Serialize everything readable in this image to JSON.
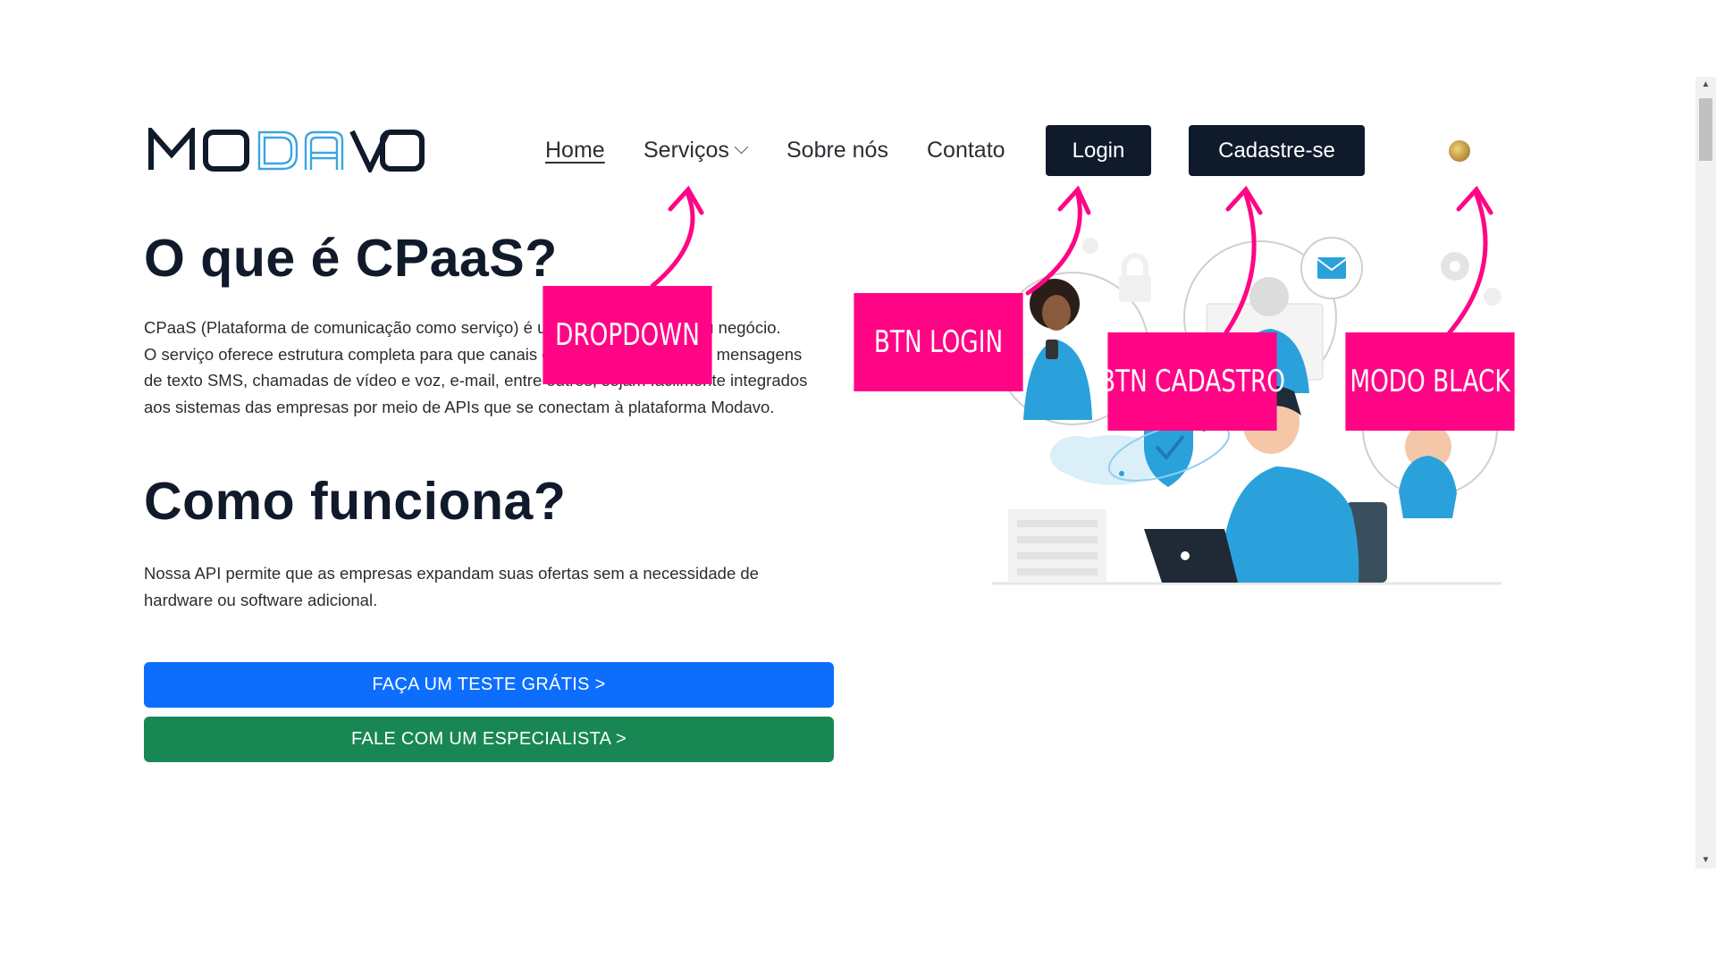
{
  "brand": {
    "logo_text": "MODAVO",
    "colors": {
      "dark": "#0f1a2b",
      "logo_accent": "#3aa6e0",
      "primary": "#0d6efd",
      "success": "#198754",
      "annotation": "#ff0586"
    }
  },
  "nav": {
    "home": "Home",
    "servicos": "Serviços",
    "sobre": "Sobre nós",
    "contato": "Contato",
    "login": "Login",
    "cadastro": "Cadastre-se",
    "theme_icon": "moon-icon"
  },
  "section1": {
    "title": "O que é CPaaS?",
    "lines": [
      "CPaaS (Plataforma de comunicação como serviço) é uma solução para o seu negócio.",
      "O serviço oferece estrutura completa para que canais de comunicação, como mensagens",
      "de texto SMS, chamadas de vídeo e voz, e-mail, entre outros, sejam facilmente integrados",
      "aos sistemas das empresas por meio de APIs que se conectam à plataforma Modavo."
    ]
  },
  "section2": {
    "title": "Como funciona?",
    "lines": [
      "Nossa API permite que as empresas expandam suas ofertas sem a necessidade de",
      "hardware ou software adicional."
    ]
  },
  "cta": {
    "trial": "FAÇA UM TESTE GRÁTIS >",
    "specialist": "FALE COM UM ESPECIALISTA >"
  },
  "annotations": {
    "dropdown": "DROPDOWN",
    "btn_login": "BTN LOGIN",
    "btn_cadastro": "BTN CADASTRO",
    "modo_black": "MODO  BLACK"
  }
}
